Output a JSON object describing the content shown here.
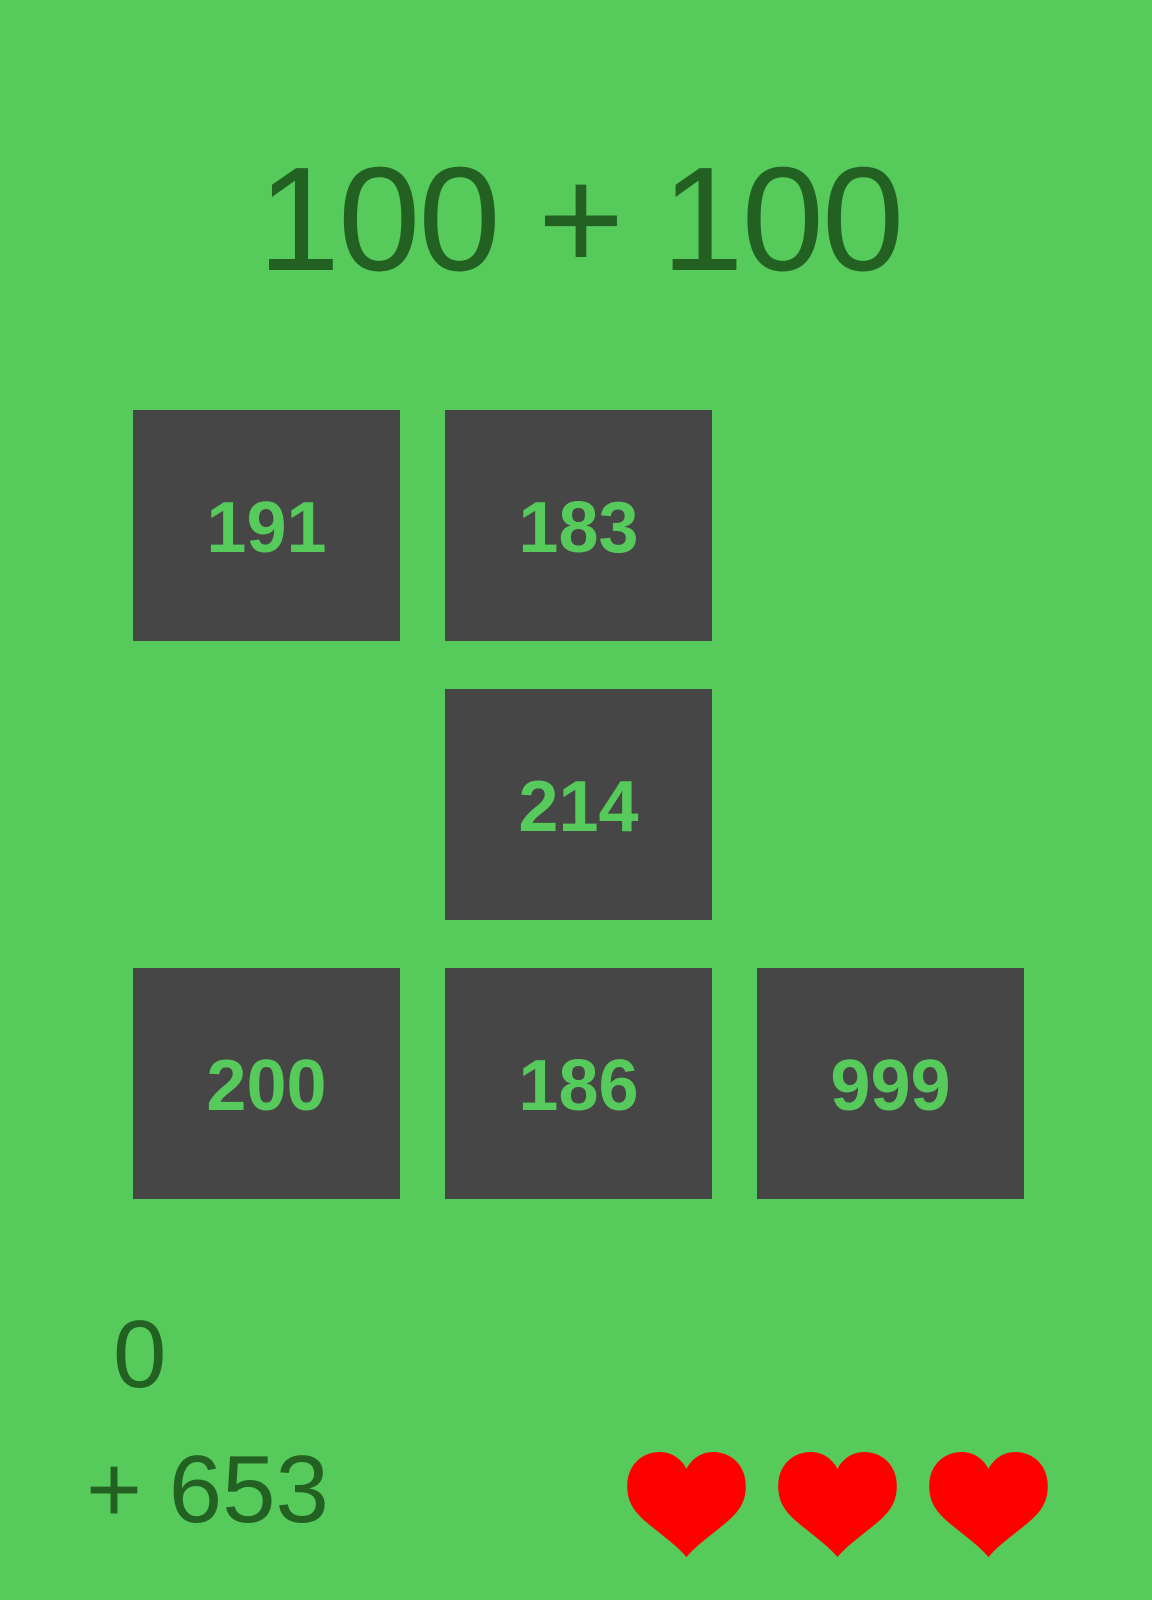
{
  "problem": {
    "text": "100 + 100"
  },
  "tiles": [
    {
      "value": "191"
    },
    {
      "value": "183"
    },
    {
      "value": "214"
    },
    {
      "value": "200"
    },
    {
      "value": "186"
    },
    {
      "value": "999"
    }
  ],
  "status": {
    "score": "0",
    "bonus": "+ 653",
    "lives": 3
  },
  "colors": {
    "background": "#57ca5c",
    "text_dark": "#236123",
    "tile": "#464646",
    "tile_text": "#57ca5c",
    "heart": "#ff0000"
  },
  "icons": {
    "life": "heart-icon"
  }
}
